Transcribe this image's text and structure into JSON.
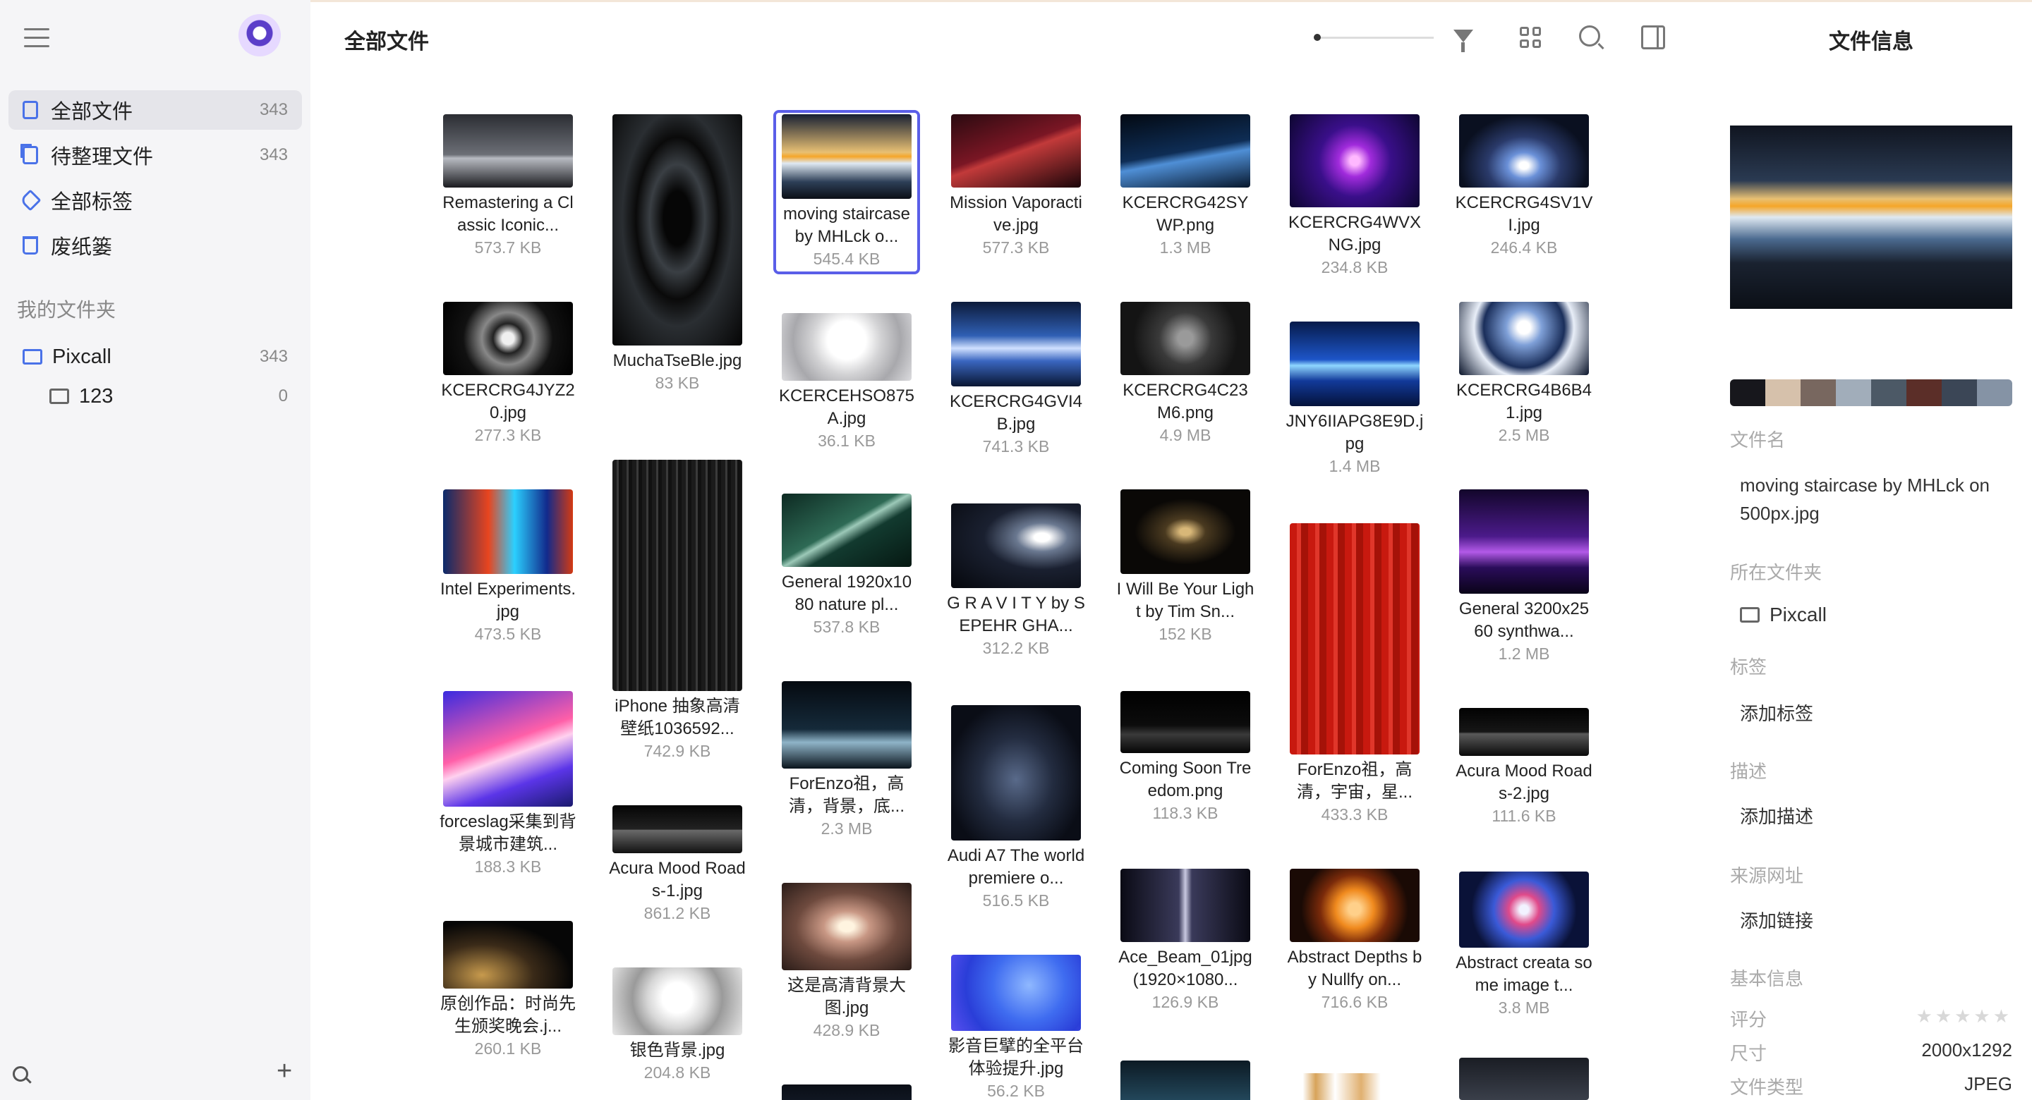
{
  "sidebar": {
    "nav": [
      {
        "label": "全部文件",
        "count": "343"
      },
      {
        "label": "待整理文件",
        "count": "343"
      },
      {
        "label": "全部标签",
        "count": ""
      },
      {
        "label": "废纸篓",
        "count": ""
      }
    ],
    "folders_title": "我的文件夹",
    "folders": [
      {
        "label": "Pixcall",
        "count": "343"
      },
      {
        "label": "123",
        "count": "0"
      }
    ],
    "add_label": "+"
  },
  "header": {
    "title": "全部文件",
    "info_title": "文件信息"
  },
  "grid": [
    {
      "name": "Remastering a Classic Iconic...",
      "size": "573.7 KB",
      "bg": "linear-gradient(180deg,#2b2d33,#6c6f76 55%,#b8bbc2 60%,#1a1b1f)"
    },
    {
      "name": "KCERCRG4JYZ20.jpg",
      "size": "277.3 KB",
      "bg": "radial-gradient(circle,#f0f0f0 0 8%,#222 20%,#888 35%,#111 60%,#000)"
    },
    {
      "name": "Intel Experiments.jpg",
      "size": "473.5 KB",
      "bg": "linear-gradient(90deg,#0b2a6b,#e8451f 35%,#2bd0ff 55%,#112a8c 80%,#d43a12)"
    },
    {
      "name": "forceslag采集到背景城市建筑...",
      "size": "188.3 KB",
      "bg": "linear-gradient(160deg,#3a2be0,#ff5fa8 45%,#ffd1ef 55%,#5b35e8 75%,#1a1a6e)"
    },
    {
      "name": "原创作品：时尚先生颁奖晚会.j...",
      "size": "260.1 KB",
      "bg": "radial-gradient(ellipse at 30% 80%,#c79a4d,#3a2a18 40%,#060606 70%)"
    },
    {
      "name": "MuchaTseBle.jpg",
      "size": "83 KB",
      "bg": "radial-gradient(ellipse at 50% 45%,#060606 0 15%,#3a3f44 30%,#0a0a0a 45%,#2a2e32 60%,#050505)"
    },
    {
      "name": "iPhone 抽象高清壁纸1036592...",
      "size": "742.9 KB",
      "bg": "repeating-linear-gradient(90deg,#1b1b1b 0 6px,#3a3a3a 6px 9px,#111 9px 14px)"
    },
    {
      "name": "Acura Mood Roads-1.jpg",
      "size": "861.2 KB",
      "bg": "linear-gradient(180deg,#050505,#222 50%,#6a6a6a 52%,#111)"
    },
    {
      "name": "银色背景.jpg",
      "size": "204.8 KB",
      "bg": "radial-gradient(circle at 50% 45%,#ffffff 0 20%,#d6d6d6 40%,#9a9a9a 60%,#e8e8e8)"
    },
    {
      "name": "moving staircase by MHLck o...",
      "size": "545.4 KB",
      "bg": "linear-gradient(180deg,#172033,#e8c073 45%,#f5a629 50%,#dfe9f2 58%,#2d3f57 80%,#0b0f16)"
    },
    {
      "name": "KCERCEHSO875A.jpg",
      "size": "36.1 KB",
      "bg": "radial-gradient(circle at 50% 40%,#ffffff 0 25%,#d2d2d4 45%,#a8a8ac 70%,#dcdcdf)"
    },
    {
      "name": "General 1920x1080 nature pl...",
      "size": "537.8 KB",
      "bg": "linear-gradient(150deg,#0d2a22,#2e6a55 45%,#9cc9b8 50%,#123a2f 60%,#061812)"
    },
    {
      "name": "ForEnzo祖，高清，背景，底...",
      "size": "2.3 MB",
      "bg": "linear-gradient(180deg,#050a10,#152a3a 55%,#8fb4c8 70%,#0a141c)"
    },
    {
      "name": "这是高清背景大图.jpg",
      "size": "428.9 KB",
      "bg": "radial-gradient(ellipse at 50% 50%,#fff4e0 0 8%,#c89784 25%,#6e4a3e 55%,#2a1c18)"
    },
    {
      "name": "Mission Vaporactive.jpg",
      "size": "577.3 KB",
      "bg": "linear-gradient(160deg,#2a0a10,#7a1624 45%,#c23a3a 52%,#1a0509)"
    },
    {
      "name": "KCERCRG4GVI4B.jpg",
      "size": "741.3 KB",
      "bg": "linear-gradient(180deg,#0c1a3a,#2f5fb4 40%,#cfe0ff 55%,#3a66c0 70%,#091632)"
    },
    {
      "name": "G R A V I T Y by SEPEHR GHA...",
      "size": "312.2 KB",
      "bg": "radial-gradient(ellipse at 70% 40%,#ffffff 0 6%,#6a7890 20%,#1a2030 45%,#05070c)"
    },
    {
      "name": "Audi A7 The world premiere o...",
      "size": "516.5 KB",
      "bg": "radial-gradient(ellipse at 50% 55%,#596a8a,#232c40 40%,#0a0d16 75%)"
    },
    {
      "name": "影音巨擘的全平台体验提升.jpg",
      "size": "56.2 KB",
      "bg": "radial-gradient(circle at 60% 40%,#8fb8ff,#3f6cf0 40%,#2a3ed8 70%,#5a4ff0)"
    },
    {
      "name": "KCERCRG42SYWP.png",
      "size": "1.3 MB",
      "bg": "linear-gradient(170deg,#030912,#0e2d55 50%,#4f8fd6 60%,#07172c)"
    },
    {
      "name": "KCERCRG4C23M6.png",
      "size": "4.9 MB",
      "bg": "radial-gradient(circle at 50% 50%,#9a9a9a 0 10%,#3a3a3a 35%,#141414 70%)"
    },
    {
      "name": "I Will Be Your Light by Tim Sn...",
      "size": "152 KB",
      "bg": "radial-gradient(ellipse at 50% 50%,#d8b778 0 6%,#4a3a20 22%,#0a0806 55%)"
    },
    {
      "name": "Coming Soon Treedom.png",
      "size": "118.3 KB",
      "bg": "linear-gradient(180deg,#000,#0c0c0c 55%,#3a3a3a 70%,#050505)"
    },
    {
      "name": "Ace_Beam_01jpg (1920×1080...",
      "size": "126.9 KB",
      "bg": "linear-gradient(90deg,#0a0a14,#3a3a5a 45%,#c8c8e0 50%,#3a3a5a 55%,#0a0a14)"
    },
    {
      "name": "KCERCRG4WVXNG.jpg",
      "size": "234.8 KB",
      "bg": "radial-gradient(circle at 50% 50%,#ffb8ff 0 6%,#a12bdc 20%,#3a0f8a 45%,#0d0630)"
    },
    {
      "name": "JNY6IIAPG8E9D.jpg",
      "size": "1.4 MB",
      "bg": "linear-gradient(180deg,#061a4a,#1d55c8 45%,#8fd6ff 52%,#123a9a 70%,#04123a)"
    },
    {
      "name": "ForEnzo祖，高清，宇宙，星...",
      "size": "433.3 KB",
      "bg": "repeating-linear-gradient(90deg,#c8190f 0 10px,#e0362a 10px 16px,#a51208 16px 26px)"
    },
    {
      "name": "Abstract Depths by Nullfy on...",
      "size": "716.6 KB",
      "bg": "radial-gradient(circle at 50% 55%,#ffd08a 0 8%,#f08a1e 25%,#7a2a0a 45%,#1a0a05 70%)"
    },
    {
      "name": "KCERCRG4SV1VI.jpg",
      "size": "246.4 KB",
      "bg": "radial-gradient(ellipse at 50% 70%,#ffffff 0 5%,#6a90d8 18%,#2a3a6a 40%,#0a1020 70%)"
    },
    {
      "name": "KCERCRG4B6B41.jpg",
      "size": "2.5 MB",
      "bg": "radial-gradient(circle at 50% 35%,#ffffff 0 8%,#7fa0d8 22%,#1a2e5a 50%,#e8eef8 62%,#0a142a)"
    },
    {
      "name": "General 3200x2560 synthwa...",
      "size": "1.2 MB",
      "bg": "linear-gradient(180deg,#12062a,#4b1a8a 45%,#b35ae8 60%,#2a0c5a 75%,#0a0318)"
    },
    {
      "name": "Acura Mood Roads-2.jpg",
      "size": "111.6 KB",
      "bg": "linear-gradient(180deg,#020202,#161616 50%,#5a5a5a 54%,#0a0a0a)"
    },
    {
      "name": "Abstract creata some image t...",
      "size": "3.8 MB",
      "bg": "radial-gradient(circle at 50% 50%,#f2f2ff 0 6%,#e04a8a 20%,#3a5ad8 40%,#0a1238 70%)"
    }
  ],
  "partial_thumbs": [
    {
      "bg": "linear-gradient(180deg,#0a0e16,#1a2434)"
    },
    {
      "bg": "linear-gradient(180deg,#0c1a24,#244a5e)"
    },
    {
      "bg": "linear-gradient(90deg,#fff 0 10%,#d7a35a 20%,#fff 35%,#e0b070 55%,#fff 70%)"
    },
    {
      "bg": "linear-gradient(180deg,#1a1d24,#3a3f4a)"
    }
  ],
  "info": {
    "palette": [
      "#17171c",
      "#d6c1ab",
      "#78675f",
      "#a1adba",
      "#4c5966",
      "#5b2e28",
      "#3b4656",
      "#8593a5"
    ],
    "filename_label": "文件名",
    "filename": "moving staircase by MHLck on 500px.jpg",
    "folder_label": "所在文件夹",
    "folder": "Pixcall",
    "tags_label": "标签",
    "tags_value": "添加标签",
    "desc_label": "描述",
    "desc_value": "添加描述",
    "source_label": "来源网址",
    "source_value": "添加链接",
    "basic_label": "基本信息",
    "rating_label": "评分",
    "rating_value": "★★★★★",
    "dim_label": "尺寸",
    "dim_value": "2000x1292",
    "type_label": "文件类型",
    "type_value": "JPEG"
  }
}
